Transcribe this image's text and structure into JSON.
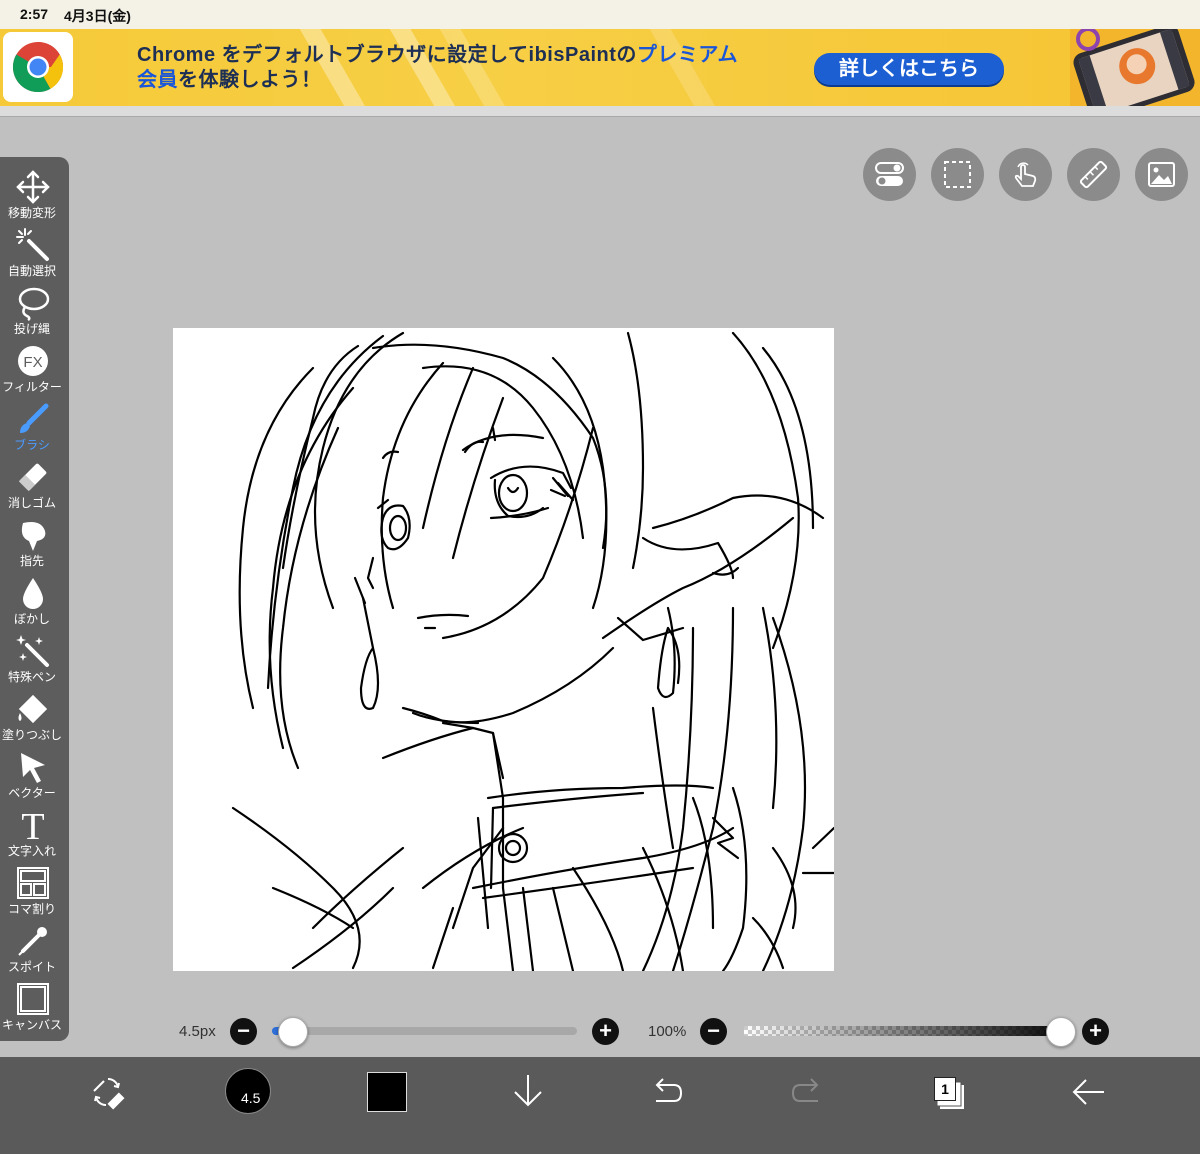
{
  "status_bar": {
    "time": "2:57",
    "date": "4月3日(金)"
  },
  "banner": {
    "line1_prefix": "Chrome をデフォルトブラウザに設定してibisPaintの",
    "line1_highlight": "プレミアム",
    "line2_highlight": "会員",
    "line2_suffix": "を体験しよう！",
    "cta": "詳しくはこちら"
  },
  "toolbar": {
    "items": [
      {
        "label": "移動変形",
        "icon": "move-icon"
      },
      {
        "label": "自動選択",
        "icon": "magic-wand-icon"
      },
      {
        "label": "投げ縄",
        "icon": "lasso-icon"
      },
      {
        "label": "フィルター",
        "icon": "fx-icon"
      },
      {
        "label": "ブラシ",
        "icon": "brush-icon"
      },
      {
        "label": "消しゴム",
        "icon": "eraser-icon"
      },
      {
        "label": "指先",
        "icon": "smudge-icon"
      },
      {
        "label": "ぼかし",
        "icon": "blur-icon"
      },
      {
        "label": "特殊ペン",
        "icon": "special-pen-icon"
      },
      {
        "label": "塗りつぶし",
        "icon": "fill-icon"
      },
      {
        "label": "ベクター",
        "icon": "vector-icon"
      },
      {
        "label": "文字入れ",
        "icon": "text-icon"
      },
      {
        "label": "コマ割り",
        "icon": "frame-divider-icon"
      },
      {
        "label": "スポイト",
        "icon": "eyedropper-icon"
      },
      {
        "label": "キャンバス",
        "icon": "canvas-icon"
      }
    ],
    "active_index": 4,
    "active_color": "#4a9bff"
  },
  "top_buttons": [
    "toggle-icon",
    "selection-icon",
    "touch-icon",
    "ruler-icon",
    "reference-image-icon"
  ],
  "brush_size": {
    "label": "4.5px",
    "minus": "−",
    "plus": "+",
    "value_fraction": 0.04
  },
  "opacity": {
    "label": "100%",
    "minus": "−",
    "plus": "+",
    "value_fraction": 1.0
  },
  "bottom_bar": {
    "brush_size_display": "4.5",
    "current_color": "#000000",
    "layer_count": "1"
  }
}
